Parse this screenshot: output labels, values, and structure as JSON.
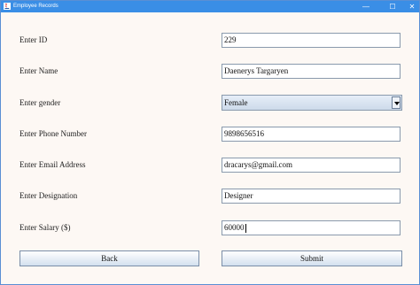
{
  "window": {
    "title": "Employee Records",
    "controls": {
      "minimize": "—",
      "maximize": "☐",
      "close": "✕"
    }
  },
  "form": {
    "id_label": "Enter ID",
    "id_value": "229",
    "name_label": "Enter Name",
    "name_value": "Daenerys Targaryen",
    "gender_label": "Enter gender",
    "gender_value": "Female",
    "phone_label": "Enter Phone Number",
    "phone_value": "9898656516",
    "email_label": "Enter Email Address",
    "email_value": "dracarys@gmail.com",
    "designation_label": "Enter Designation",
    "designation_value": "Designer",
    "salary_label": "Enter Salary ($)",
    "salary_value": "60000"
  },
  "buttons": {
    "back": "Back",
    "submit": "Submit"
  }
}
